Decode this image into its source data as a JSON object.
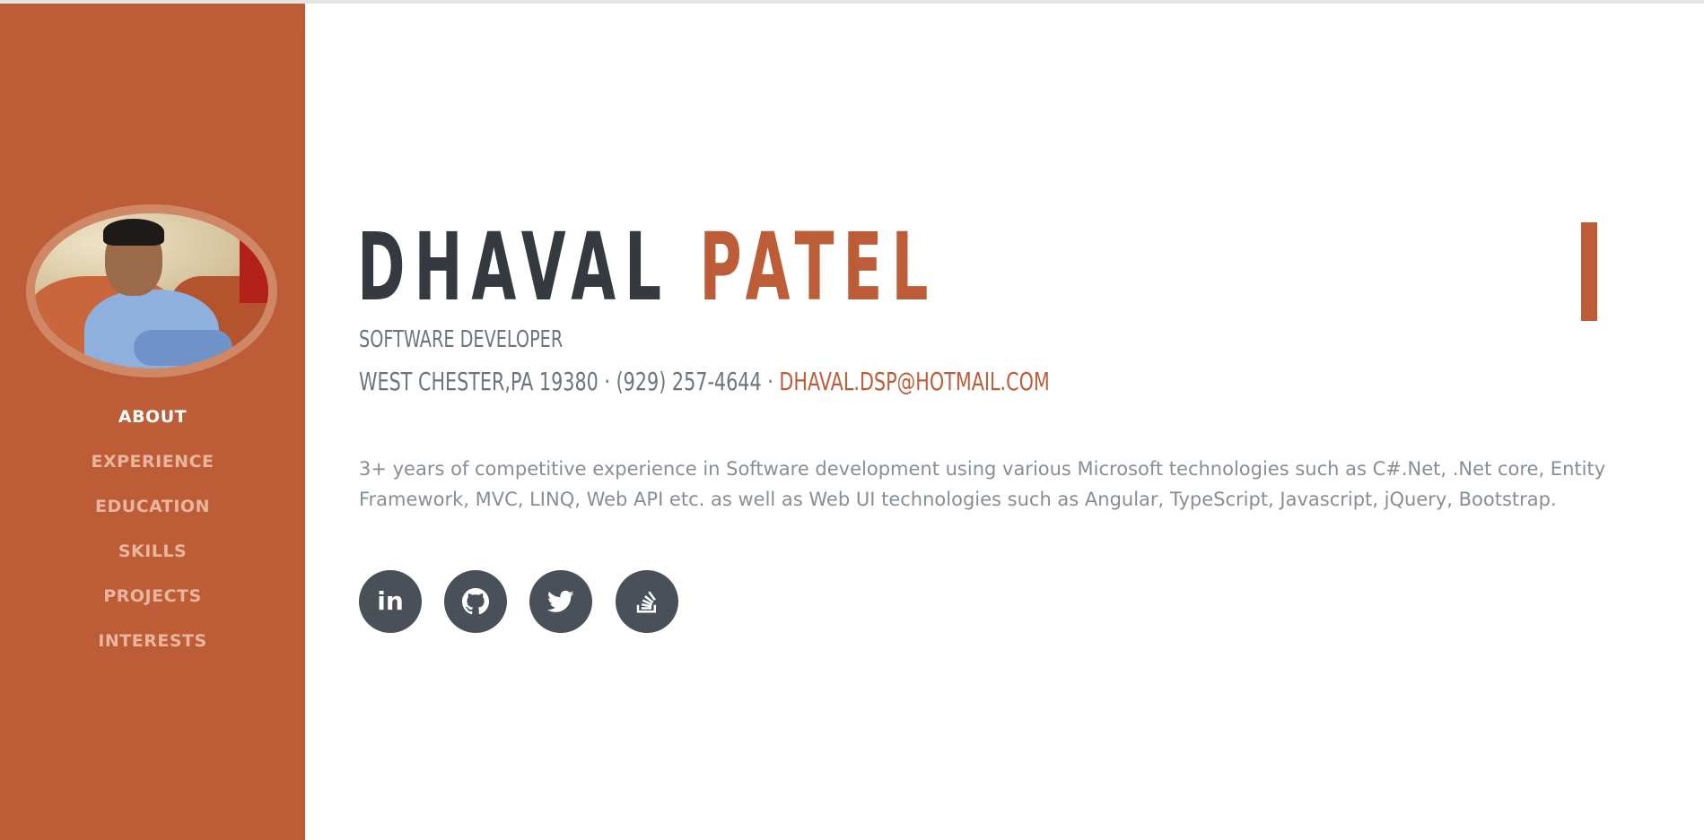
{
  "profile": {
    "first_name": "DHAVAL",
    "last_name": "PATEL",
    "role": "Software Developer",
    "address": "West Chester,PA 19380 · (929) 257-4644 ·",
    "email": "dhaval.dsp@hotmail.com",
    "summary": "3+ years of competitive experience in Software development using various Microsoft technologies such as C#.Net, .Net core, Entity Framework, MVC, LINQ, Web API etc. as well as Web UI technologies such as Angular, TypeScript, Javascript, jQuery, Bootstrap."
  },
  "nav": {
    "items": [
      {
        "label": "ABOUT",
        "active": true
      },
      {
        "label": "EXPERIENCE",
        "active": false
      },
      {
        "label": "EDUCATION",
        "active": false
      },
      {
        "label": "SKILLS",
        "active": false
      },
      {
        "label": "PROJECTS",
        "active": false
      },
      {
        "label": "INTERESTS",
        "active": false
      }
    ]
  },
  "social": {
    "icons": [
      "linkedin-icon",
      "github-icon",
      "twitter-icon",
      "stackoverflow-icon"
    ],
    "linkedin_glyph": "in"
  },
  "colors": {
    "primary": "#bd5d38",
    "dark": "#343a40",
    "muted": "#6c757d",
    "social_bg": "#495057"
  }
}
